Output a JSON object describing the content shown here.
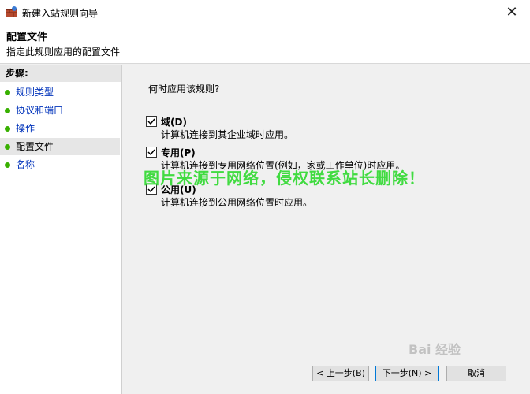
{
  "window": {
    "title": "新建入站规则向导",
    "close_glyph": "✕"
  },
  "header": {
    "title": "配置文件",
    "subtitle": "指定此规则应用的配置文件"
  },
  "sidebar": {
    "steps_label": "步骤:",
    "items": [
      {
        "label": "规则类型",
        "current": false
      },
      {
        "label": "协议和端口",
        "current": false
      },
      {
        "label": "操作",
        "current": false
      },
      {
        "label": "配置文件",
        "current": true
      },
      {
        "label": "名称",
        "current": false
      }
    ]
  },
  "main": {
    "question": "何时应用该规则?",
    "options": [
      {
        "label": "域(D)",
        "description": "计算机连接到其企业域时应用。",
        "checked": true
      },
      {
        "label": "专用(P)",
        "description": "计算机连接到专用网络位置(例如，家或工作单位)时应用。",
        "checked": true
      },
      {
        "label": "公用(U)",
        "description": "计算机连接到公用网络位置时应用。",
        "checked": true
      }
    ]
  },
  "watermark": "图片来源于网络，侵权联系站长删除！",
  "baidu_logo": "Bai 经验",
  "buttons": {
    "back": "< 上一步(B)",
    "next": "下一步(N) >",
    "cancel": "取消"
  },
  "colors": {
    "link_blue": "#0033bb",
    "bullet_green": "#38b000",
    "watermark_green": "#2fd92f",
    "primary_border": "#0078d7"
  }
}
